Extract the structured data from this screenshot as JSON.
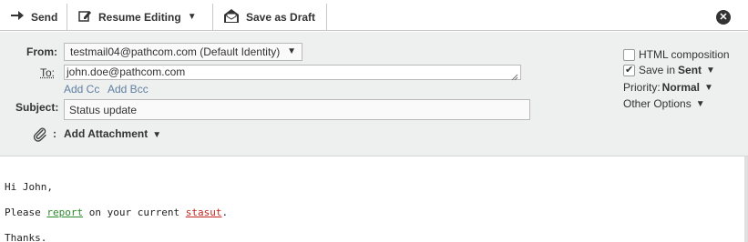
{
  "toolbar": {
    "send_label": "Send",
    "resume_label": "Resume Editing",
    "draft_label": "Save as Draft",
    "close_icon": "close-icon"
  },
  "header": {
    "from_label": "From:",
    "from_value": "testmail04@pathcom.com (Default Identity)",
    "to_label": "To:",
    "to_value": "john.doe@pathcom.com",
    "add_cc": "Add Cc",
    "add_bcc": "Add Bcc",
    "subject_label": "Subject:",
    "subject_value": "Status update",
    "attach_colon": ":",
    "attach_label": "Add Attachment"
  },
  "options": {
    "html_composition": "HTML composition",
    "html_checked": false,
    "save_in": "Save in",
    "save_folder": "Sent",
    "save_checked": true,
    "priority_label": "Priority:",
    "priority_value": "Normal",
    "other_options": "Other Options"
  },
  "body": {
    "greeting": "Hi John,",
    "line_start": "Please ",
    "word_report": "report",
    "line_mid": " on your current ",
    "word_stasut": "stasut",
    "line_end": ".",
    "closing": "Thanks."
  },
  "colors": {
    "link": "#5f7ea0",
    "spell_ok": "#2a8a2a",
    "spell_bad": "#c0271f",
    "header_bg": "#eef0f0"
  }
}
